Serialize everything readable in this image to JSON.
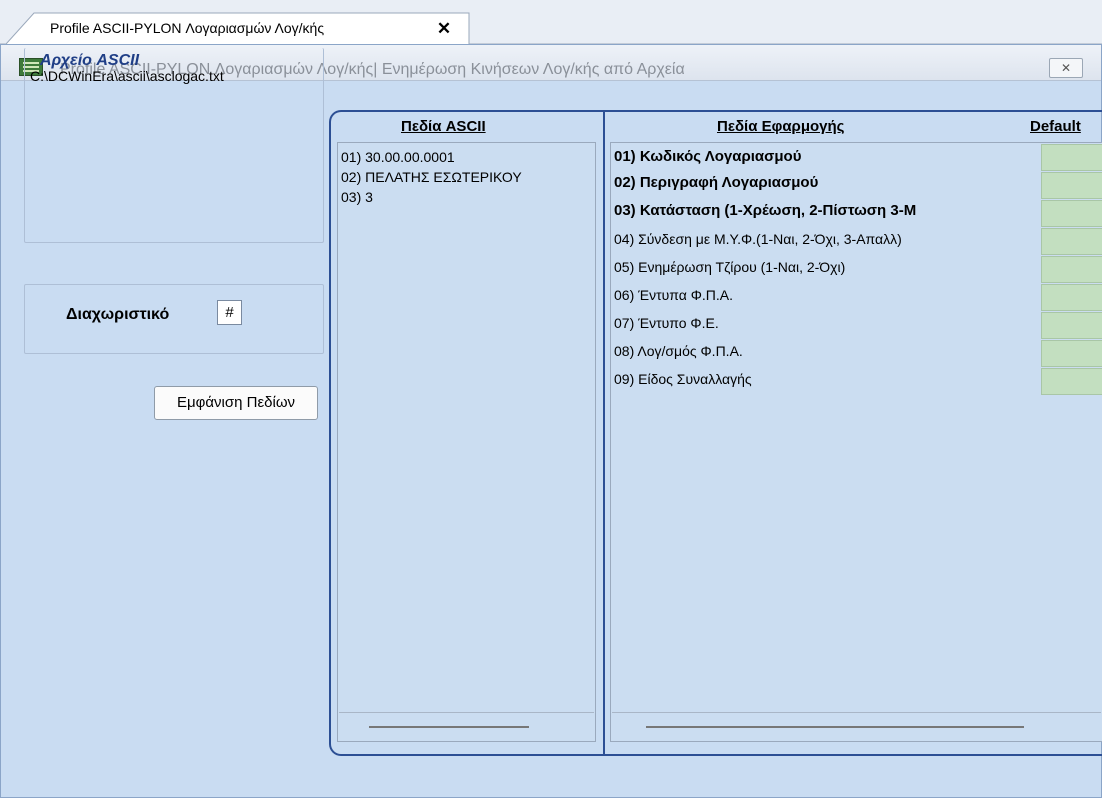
{
  "tab": {
    "label": "Profile ASCII-PYLON Λογαριασμών Λογ/κής",
    "close": "✕"
  },
  "window": {
    "title": "Profile ASCII-PYLON Λογαριασμών Λογ/κής| Ενημέρωση Κινήσεων Λογ/κής από Αρχεία",
    "close": "✕"
  },
  "left": {
    "file_label": "Αρχείο ASCII",
    "file_path": "C:\\DCWinEra\\ascii\\asclogac.txt",
    "separator_label": "Διαχωριστικό",
    "separator_value": "#",
    "show_fields_button": "Εμφάνιση Πεδίων"
  },
  "ascii_fields": {
    "header": "Πεδία ASCII",
    "items": [
      "01) 30.00.00.0001",
      "02) ΠΕΛΑΤΗΣ ΕΣΩΤΕΡΙΚΟΥ",
      "03) 3"
    ]
  },
  "app_fields": {
    "header": "Πεδία Εφαρμογής",
    "default_header": "Default",
    "items": [
      "01) Κωδικός Λογαριασμού",
      "02) Περιγραφή Λογαριασμού",
      "03) Κατάσταση (1-Χρέωση, 2-Πίστωση 3-Μ",
      "04) Σύνδεση με Μ.Υ.Φ.(1-Ναι, 2-Όχι, 3-Απαλλ)",
      "05) Ενημέρωση Τζίρου (1-Ναι, 2-Όχι)",
      "06) Έντυπα Φ.Π.Α.",
      "07) Έντυπο Φ.Ε.",
      "08) Λογ/σμός Φ.Π.Α.",
      "09) Είδος Συναλλαγής"
    ]
  },
  "colors": {
    "background": "#c9dcf2",
    "frame": "#2c4f94",
    "default_cell": "#c3dfc0",
    "file_label": "#1f3e86"
  }
}
